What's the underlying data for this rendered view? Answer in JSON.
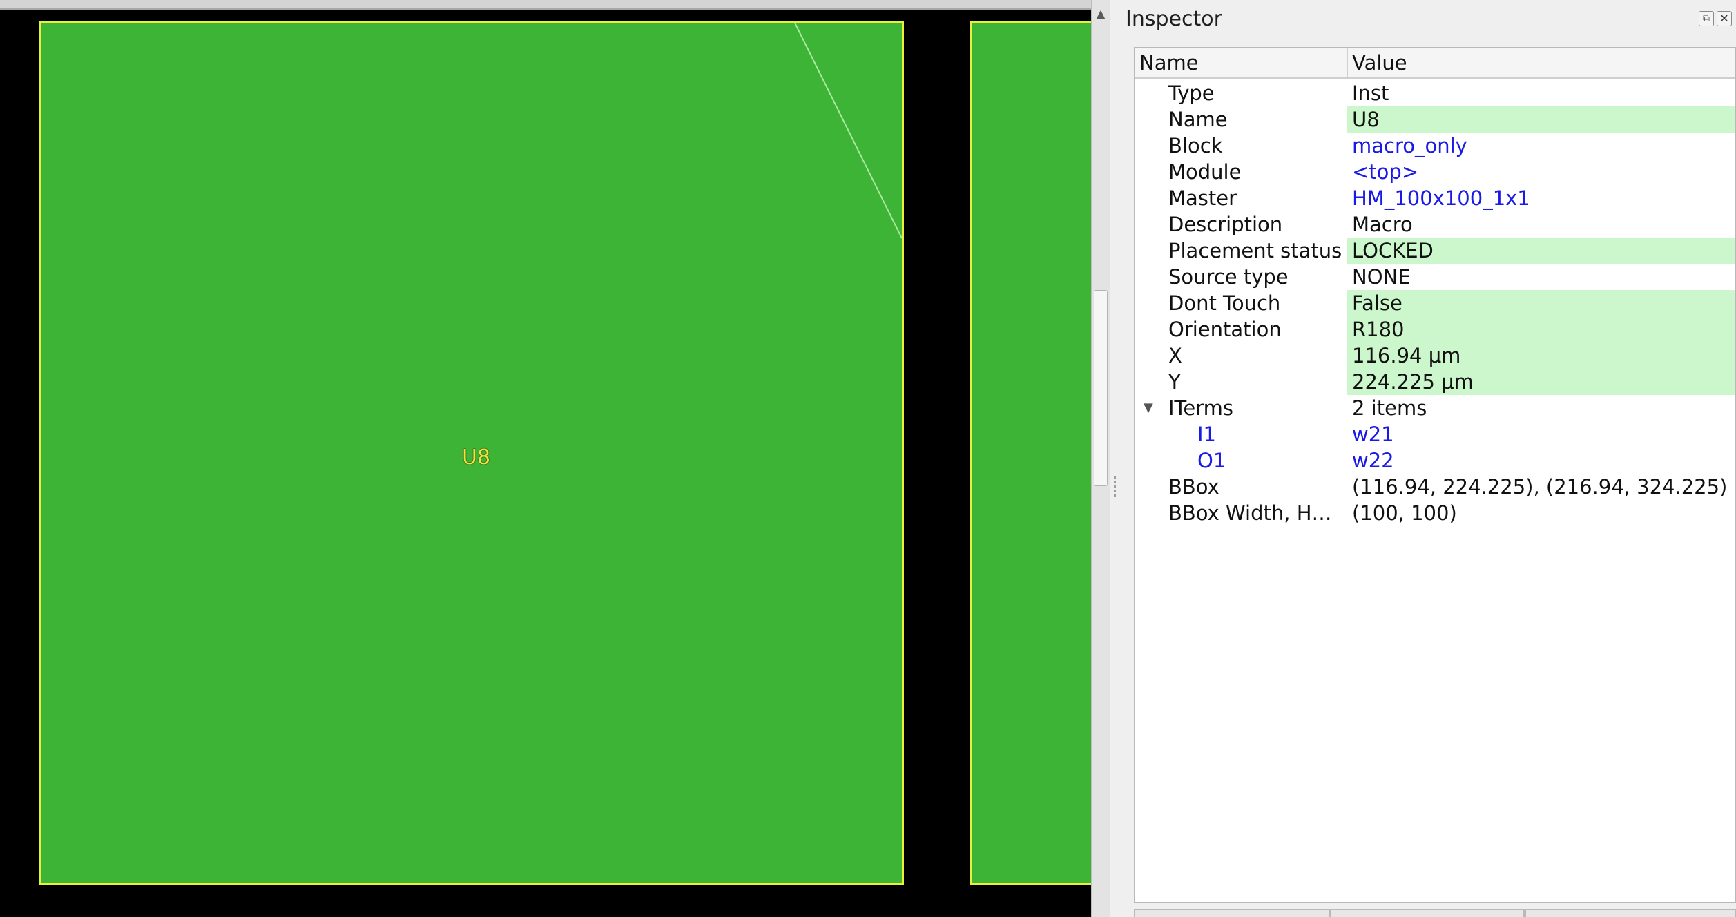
{
  "canvas": {
    "instance_label": "U8",
    "colors": {
      "background": "#000000",
      "instance_fill": "#3db435",
      "instance_outline": "#e8f03a",
      "label": "#f2e23b"
    }
  },
  "inspector": {
    "title": "Inspector",
    "float_icon": "float-icon",
    "close_icon": "close-icon",
    "columns": {
      "name": "Name",
      "value": "Value"
    },
    "properties": {
      "type": {
        "name": "Type",
        "value": "Inst"
      },
      "name": {
        "name": "Name",
        "value": "U8"
      },
      "block": {
        "name": "Block",
        "value": "macro_only"
      },
      "module": {
        "name": "Module",
        "value": "<top>"
      },
      "master": {
        "name": "Master",
        "value": "HM_100x100_1x1"
      },
      "description": {
        "name": "Description",
        "value": "Macro"
      },
      "placement_status": {
        "name": "Placement status",
        "value": "LOCKED"
      },
      "source_type": {
        "name": "Source type",
        "value": "NONE"
      },
      "dont_touch": {
        "name": "Dont Touch",
        "value": "False"
      },
      "orientation": {
        "name": "Orientation",
        "value": "R180"
      },
      "x": {
        "name": "X",
        "value": "116.94 μm"
      },
      "y": {
        "name": "Y",
        "value": "224.225 μm"
      },
      "iterms": {
        "name": "ITerms",
        "value": "2 items"
      },
      "iterm_i1": {
        "name": "I1",
        "value": "w21"
      },
      "iterm_o1": {
        "name": "O1",
        "value": "w22"
      },
      "bbox": {
        "name": "BBox",
        "value": "(116.94, 224.225), (216.94, 324.225)"
      },
      "bbox_wh": {
        "name": "BBox Width, H…",
        "value": "(100, 100)"
      }
    },
    "colors": {
      "editable_bg": "#ccf7cc",
      "link": "#1a1ae6"
    }
  }
}
